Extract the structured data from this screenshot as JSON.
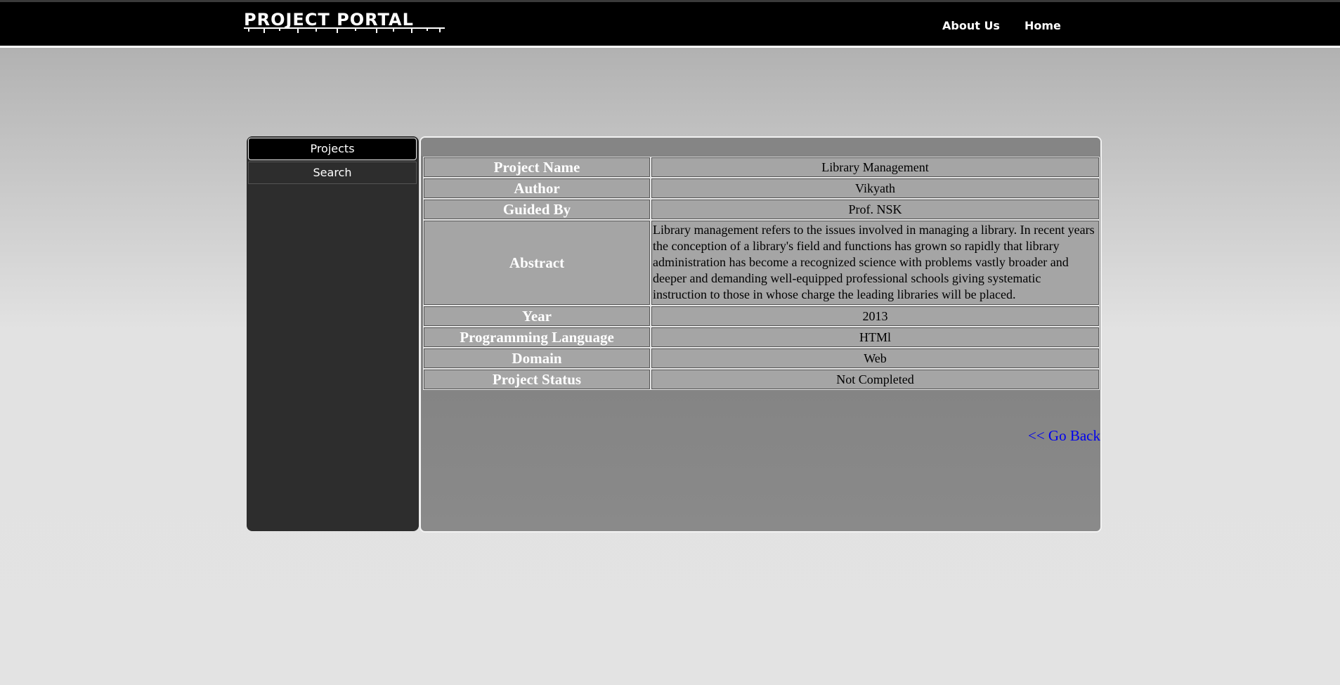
{
  "header": {
    "logo_text": "PROJECT PORTAL",
    "nav": {
      "about": "About Us",
      "home": "Home"
    }
  },
  "sidebar": {
    "items": [
      {
        "label": "Projects",
        "active": true
      },
      {
        "label": "Search",
        "active": false
      }
    ]
  },
  "project": {
    "rows": [
      {
        "label": "Project Name",
        "value": "Library Management"
      },
      {
        "label": "Author",
        "value": "Vikyath"
      },
      {
        "label": "Guided By",
        "value": "Prof. NSK"
      },
      {
        "label": "Abstract",
        "value": "Library management refers to the issues involved in managing a library. In recent years the conception of a library's field and functions has grown so rapidly that library administration has become a recognized science with problems vastly broader and deeper and demanding well-equipped professional schools giving systematic instruction to those in whose charge the leading libraries will be placed."
      },
      {
        "label": "Year",
        "value": "2013"
      },
      {
        "label": "Programming Language",
        "value": "HTMl"
      },
      {
        "label": "Domain",
        "value": "Web"
      },
      {
        "label": "Project Status",
        "value": "Not Completed"
      }
    ],
    "go_back": "<< Go Back"
  },
  "colors": {
    "topbar": "#000000",
    "sidebar": "#2d2d2d",
    "link": "#0000ee"
  }
}
